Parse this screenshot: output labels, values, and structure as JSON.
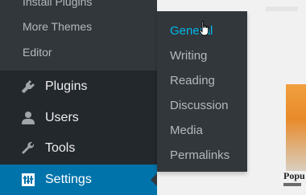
{
  "admin_menu": {
    "submenu_items": [
      {
        "label": "Install Plugins"
      },
      {
        "label": "More Themes"
      },
      {
        "label": "Editor"
      }
    ],
    "items": [
      {
        "label": "Plugins",
        "icon": "plugin-icon"
      },
      {
        "label": "Users",
        "icon": "user-icon"
      },
      {
        "label": "Tools",
        "icon": "wrench-icon"
      },
      {
        "label": "Settings",
        "icon": "settings-icon",
        "active": true
      }
    ]
  },
  "settings_flyout": {
    "items": [
      {
        "label": "General",
        "hovered": true
      },
      {
        "label": "Writing"
      },
      {
        "label": "Reading"
      },
      {
        "label": "Discussion"
      },
      {
        "label": "Media"
      },
      {
        "label": "Permalinks"
      }
    ]
  },
  "background_content": {
    "text": "Popu"
  },
  "colors": {
    "menu_bg": "#23282d",
    "submenu_bg": "#32373c",
    "active_bg": "#0073aa",
    "hover_text": "#00b9eb",
    "menu_text": "#eeeeee",
    "submenu_text": "#b4b9be"
  }
}
